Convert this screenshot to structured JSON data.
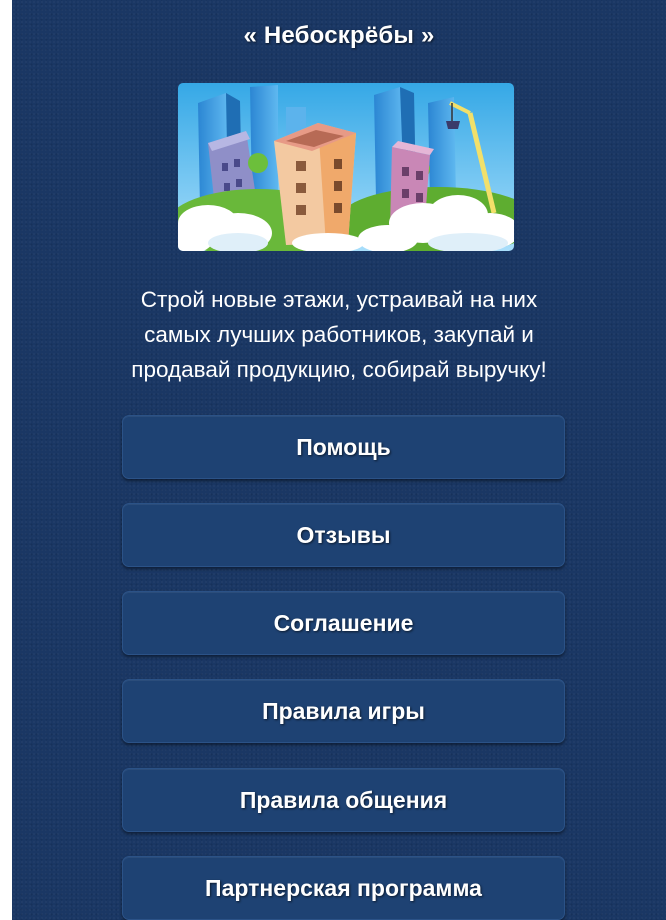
{
  "game": {
    "title": "« Небоскрёбы »",
    "description_lines": [
      "Строй новые этажи, устраивай на них",
      "самых лучших работников, закупай и",
      "продавай продукцию, собирай выручку!"
    ]
  },
  "menu": {
    "items": [
      {
        "label": "Помощь"
      },
      {
        "label": "Отзывы"
      },
      {
        "label": "Соглашение"
      },
      {
        "label": "Правила игры"
      },
      {
        "label": "Правила общения"
      },
      {
        "label": "Партнерская программа"
      }
    ]
  },
  "colors": {
    "background": "#1a3764",
    "button": "#1e4273",
    "text": "#ffffff"
  }
}
